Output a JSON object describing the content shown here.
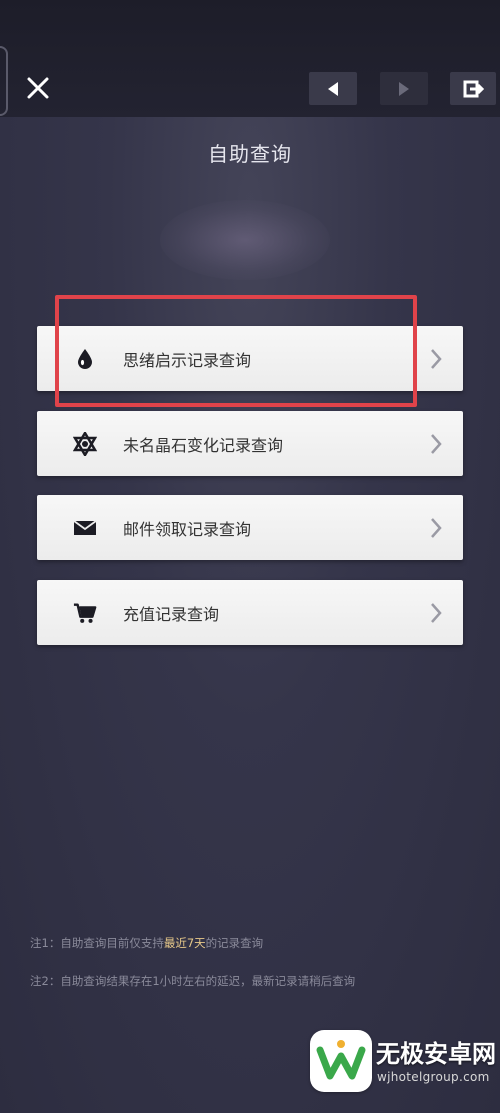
{
  "header": {
    "title": "自助查询"
  },
  "menu": [
    {
      "label": "思绪启示记录查询",
      "icon": "drop-icon"
    },
    {
      "label": "未名晶石变化记录查询",
      "icon": "hexagram-icon"
    },
    {
      "label": "邮件领取记录查询",
      "icon": "mail-icon"
    },
    {
      "label": "充值记录查询",
      "icon": "cart-icon"
    }
  ],
  "notes": {
    "note1_prefix": "注1：自助查询目前仅支持",
    "note1_highlight": "最近7天",
    "note1_suffix": "的记录查询",
    "note2": "注2：自助查询结果存在1小时左右的延迟，最新记录请稍后查询"
  },
  "watermark": {
    "title": "无极安卓网",
    "url": "wjhotelgroup.com"
  },
  "colors": {
    "highlight_border": "#e0434a",
    "note_highlight": "#e8c98a",
    "card_bg": "#f2f2f2",
    "background": "#2f2f42"
  }
}
